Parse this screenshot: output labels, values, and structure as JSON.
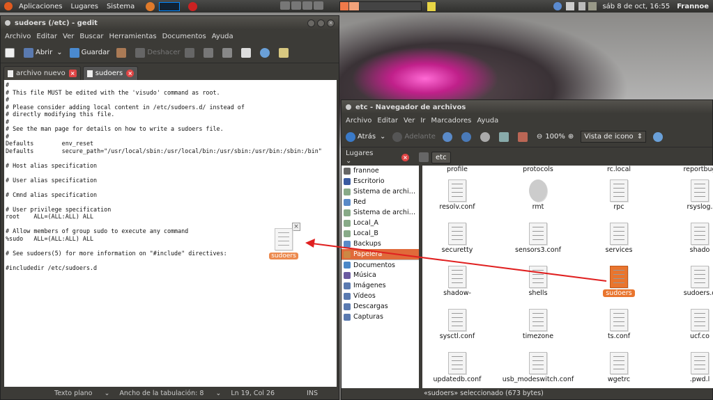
{
  "panel": {
    "menu": [
      "Aplicaciones",
      "Lugares",
      "Sistema"
    ],
    "clock": "sáb 8 de oct, 16:55",
    "user": "Frannoe"
  },
  "gedit": {
    "title": "sudoers (/etc) - gedit",
    "menu": [
      "Archivo",
      "Editar",
      "Ver",
      "Buscar",
      "Herramientas",
      "Documentos",
      "Ayuda"
    ],
    "toolbar": {
      "open": "Abrir",
      "save": "Guardar",
      "undo": "Deshacer"
    },
    "tabs": [
      "archivo nuevo",
      "sudoers"
    ],
    "content": "#\n# This file MUST be edited with the 'visudo' command as root.\n#\n# Please consider adding local content in /etc/sudoers.d/ instead of\n# directly modifying this file.\n#\n# See the man page for details on how to write a sudoers file.\n#\nDefaults        env_reset\nDefaults        secure_path=\"/usr/local/sbin:/usr/local/bin:/usr/sbin:/usr/bin:/sbin:/bin\"\n\n# Host alias specification\n\n# User alias specification\n\n# Cmnd alias specification\n\n# User privilege specification\nroot    ALL=(ALL:ALL) ALL\n\n# Allow members of group sudo to execute any command\n%sudo   ALL=(ALL:ALL) ALL\n\n# See sudoers(5) for more information on \"#include\" directives:\n\n#includedir /etc/sudoers.d",
    "drag_label": "sudoers",
    "status": {
      "mode": "Texto plano",
      "tab": "Ancho de la tabulación:  8",
      "pos": "Ln 19, Col 26",
      "ins": "INS"
    }
  },
  "nautilus": {
    "title": "etc - Navegador de archivos",
    "menu": [
      "Archivo",
      "Editar",
      "Ver",
      "Ir",
      "Marcadores",
      "Ayuda"
    ],
    "back": "Atrás",
    "forward": "Adelante",
    "zoom": "100%",
    "view": "Vista de icono",
    "places": "Lugares",
    "path": "etc",
    "sidebar": [
      "frannoe",
      "Escritorio",
      "Sistema de archi…",
      "Red",
      "Sistema de archi…",
      "Local_A",
      "Local_B",
      "Backups",
      "Papelera",
      "Documentos",
      "Música",
      "Imágenes",
      "Vídeos",
      "Descargas",
      "Capturas"
    ],
    "files_top": [
      "profile",
      "protocols",
      "rc.local",
      "reportbug"
    ],
    "files": [
      "resolv.conf",
      "rmt",
      "rpc",
      "rsyslog.",
      "securetty",
      "sensors3.conf",
      "services",
      "shado",
      "shadow-",
      "shells",
      "sudoers",
      "sudoers.d",
      "sysctl.conf",
      "timezone",
      "ts.conf",
      "ucf.co",
      "updatedb.conf",
      "usb_modeswitch.conf",
      "wgetrc",
      ".pwd.l"
    ],
    "status": "«sudoers» seleccionado (673 bytes)"
  }
}
